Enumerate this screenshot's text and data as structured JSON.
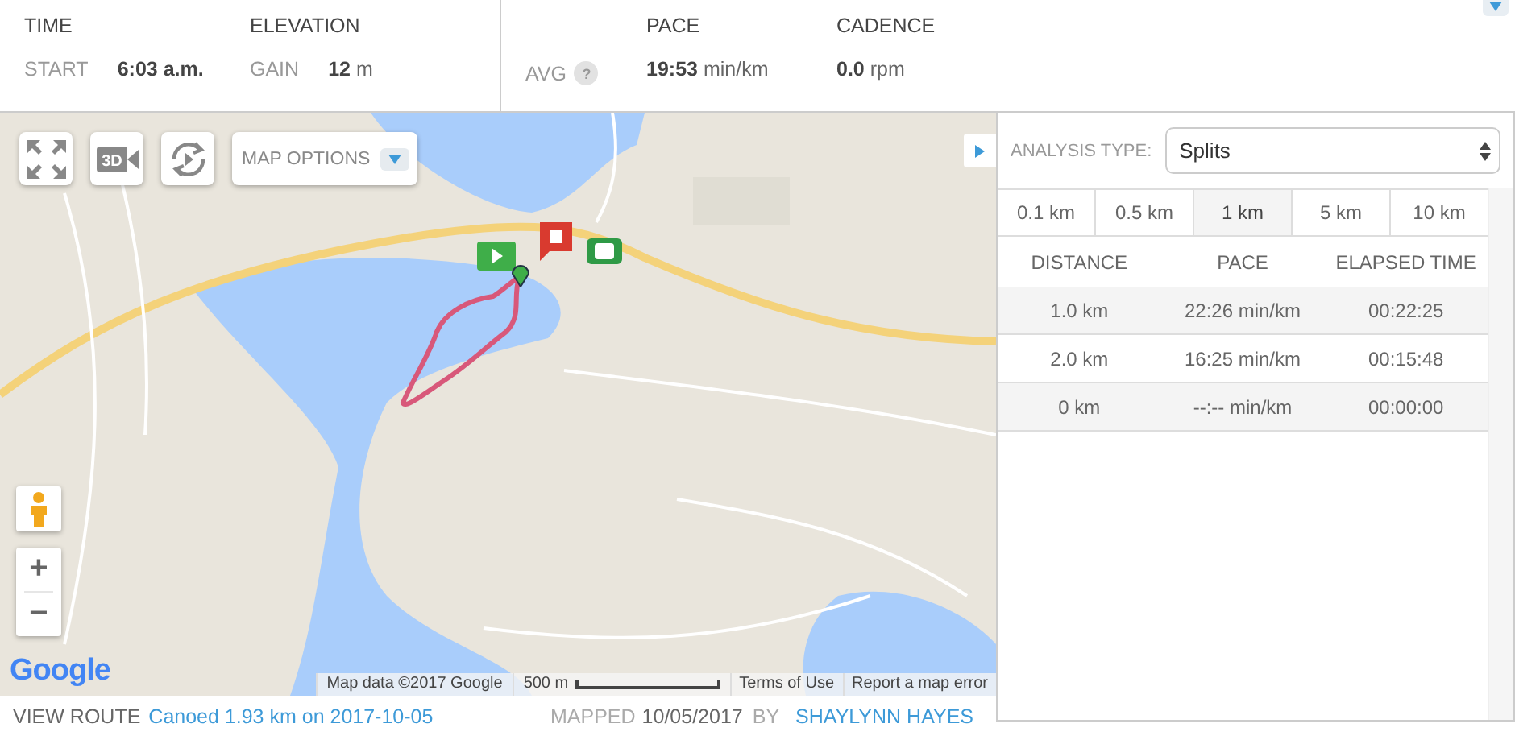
{
  "summary": {
    "left_stats": [
      {
        "heading": "TIME",
        "label": "START",
        "value": "6:03 a.m."
      },
      {
        "heading": "ELEVATION",
        "label": "GAIN",
        "value": "12",
        "unit": "m"
      }
    ],
    "avg": {
      "label": "AVG",
      "help": "?",
      "metrics": [
        {
          "heading": "PACE",
          "value": "19:53",
          "unit": "min/km"
        },
        {
          "heading": "CADENCE",
          "value": "0.0",
          "unit": "rpm"
        }
      ]
    }
  },
  "map": {
    "view_3d_label": "3D",
    "options_label": "MAP OPTIONS",
    "zoom_in": "+",
    "zoom_out": "−",
    "logo": "Google",
    "attribution": "Map data ©2017 Google",
    "scale": "500 m",
    "links": [
      "Terms of Use",
      "Report a map error"
    ]
  },
  "analysis": {
    "label": "ANALYSIS TYPE:",
    "type": "Splits",
    "tabs": [
      {
        "label": "0.1 km",
        "selected": false
      },
      {
        "label": "0.5 km",
        "selected": false
      },
      {
        "label": "1 km",
        "selected": true
      },
      {
        "label": "5 km",
        "selected": false
      },
      {
        "label": "10 km",
        "selected": false
      }
    ],
    "columns": [
      "DISTANCE",
      "PACE",
      "ELAPSED TIME"
    ],
    "rows": [
      [
        "1.0 km",
        "22:26 min/km",
        "00:22:25"
      ],
      [
        "2.0 km",
        "16:25 min/km",
        "00:15:48"
      ],
      [
        "0 km",
        "--:-- min/km",
        "00:00:00"
      ]
    ]
  },
  "footer": {
    "label": "VIEW ROUTE",
    "route_link": "Canoed 1.93 km on 2017-10-05",
    "mapped_label": "MAPPED",
    "mapped_date": "10/05/2017",
    "by_label": "BY",
    "author": "SHAYLYNN HAYES"
  }
}
